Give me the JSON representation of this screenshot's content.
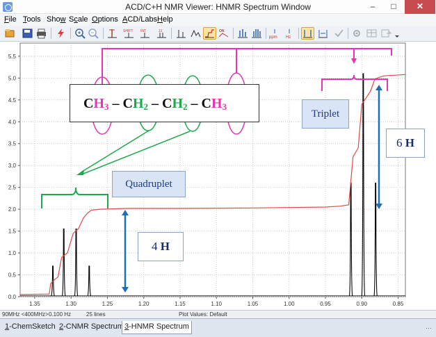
{
  "window": {
    "title": "ACD/C+H NMR Viewer: HNMR Spectrum Window",
    "min_glyph": "–",
    "max_glyph": "□",
    "close_glyph": "✕"
  },
  "menu": [
    {
      "prefix": "",
      "ul": "F",
      "rest": "ile"
    },
    {
      "prefix": "",
      "ul": "T",
      "rest": "ools"
    },
    {
      "prefix": "Sho",
      "ul": "w",
      "rest": ""
    },
    {
      "prefix": "S",
      "ul": "c",
      "rest": "ale"
    },
    {
      "prefix": "",
      "ul": "O",
      "rest": "ptions"
    },
    {
      "prefix": "",
      "ul": "A",
      "rest": "CD/Labs"
    },
    {
      "prefix": "",
      "ul": "H",
      "rest": "elp"
    }
  ],
  "toolbar": {
    "icons": [
      "open-icon",
      "save-icon",
      "print-icon",
      "lightning-icon",
      "zoom-in-icon",
      "zoom-out-icon",
      "peak-icon",
      "shift-icon",
      "integral-icon",
      "j-coupling-icon",
      "plot-icon",
      "on-off-icon",
      "spectrum-icon",
      "spectrum-multi-icon",
      "ppm-icon",
      "hz-icon",
      "cursor-icon",
      "compare-icon",
      "check-icon",
      "settings-icon"
    ],
    "labels": {
      "shift": "SHIFT",
      "integral": "INT",
      "j": "JJ",
      "ppm": "ppm",
      "hz": "Hz",
      "on": "ON"
    }
  },
  "chart_data": {
    "type": "line",
    "title": "",
    "xlabel": "",
    "ylabel": "",
    "x_reversed": true,
    "xlim": [
      1.37,
      0.84
    ],
    "ylim": [
      0,
      5.8
    ],
    "x_ticks": [
      "1.35",
      "1.30",
      "1.25",
      "1.20",
      "1.15",
      "1.10",
      "1.05",
      "1.00",
      "0.95",
      "0.90",
      "0.85"
    ],
    "x_tick_values": [
      1.35,
      1.3,
      1.25,
      1.2,
      1.15,
      1.1,
      1.05,
      1.0,
      0.95,
      0.9,
      0.85
    ],
    "y_ticks": [
      "0.0",
      "0.5",
      "1.0",
      "1.5",
      "2.0",
      "2.5",
      "3.0",
      "3.5",
      "4.0",
      "4.5",
      "5.0",
      "5.5"
    ],
    "y_tick_values": [
      0,
      0.5,
      1.0,
      1.5,
      2.0,
      2.5,
      3.0,
      3.5,
      4.0,
      4.5,
      5.0,
      5.5
    ],
    "grid": true,
    "peaks": [
      {
        "x": 1.325,
        "height": 0.7
      },
      {
        "x": 1.31,
        "height": 1.55
      },
      {
        "x": 1.293,
        "height": 1.55
      },
      {
        "x": 1.275,
        "height": 0.7
      },
      {
        "x": 0.915,
        "height": 2.6
      },
      {
        "x": 0.898,
        "height": 5.1
      },
      {
        "x": 0.881,
        "height": 2.6
      }
    ],
    "integral_curve": [
      [
        1.37,
        0.05
      ],
      [
        1.33,
        0.06
      ],
      [
        1.328,
        0.3
      ],
      [
        1.322,
        0.4
      ],
      [
        1.318,
        0.45
      ],
      [
        1.313,
        0.9
      ],
      [
        1.305,
        1.0
      ],
      [
        1.297,
        1.45
      ],
      [
        1.29,
        1.55
      ],
      [
        1.283,
        1.8
      ],
      [
        1.278,
        1.9
      ],
      [
        1.272,
        1.98
      ],
      [
        1.26,
        2.0
      ],
      [
        1.22,
        2.02
      ],
      [
        1.15,
        2.02
      ],
      [
        1.05,
        2.03
      ],
      [
        0.95,
        2.05
      ],
      [
        0.93,
        2.07
      ],
      [
        0.918,
        2.1
      ],
      [
        0.912,
        3.2
      ],
      [
        0.905,
        3.4
      ],
      [
        0.9,
        4.4
      ],
      [
        0.894,
        4.55
      ],
      [
        0.888,
        4.7
      ],
      [
        0.882,
        4.98
      ],
      [
        0.87,
        5.05
      ],
      [
        0.84,
        5.08
      ]
    ],
    "colors": {
      "peaks": "#000000",
      "integral": "#e34848",
      "grid": "#c9c9c9",
      "background": "#ffffff"
    }
  },
  "annotations": {
    "formula": {
      "parts": [
        {
          "c": "C",
          "h": "H",
          "n": "3",
          "color": "magenta"
        },
        {
          "sep": " – "
        },
        {
          "c": "C",
          "h": "H",
          "n": "2",
          "color": "green"
        },
        {
          "sep": " – "
        },
        {
          "c": "C",
          "h": "H",
          "n": "2",
          "color": "green"
        },
        {
          "sep": " – "
        },
        {
          "c": "C",
          "h": "H",
          "n": "3",
          "color": "magenta"
        }
      ]
    },
    "quadruplet_label": "Quadruplet",
    "triplet_label": "Triplet",
    "h4_number": "4",
    "h4_letter": "H",
    "h6_number": "6",
    "h6_letter": "H",
    "colors": {
      "magenta": "#e535b5",
      "green": "#1fa84b",
      "blue_arrow": "#1f6fb2"
    }
  },
  "status": {
    "freq": "90MHz <400MHz>",
    "resolution": "0.100 Hz",
    "lines": "25 lines",
    "plot_values": "Plot Values: Default"
  },
  "tabs": [
    {
      "num": "1",
      "label": "-ChemSketch",
      "active": false
    },
    {
      "num": "2",
      "label": "-CNMR Spectrum",
      "active": false
    },
    {
      "num": "3",
      "label": "-HNMR Spectrum",
      "active": true
    }
  ],
  "tab_grip": "⋯"
}
